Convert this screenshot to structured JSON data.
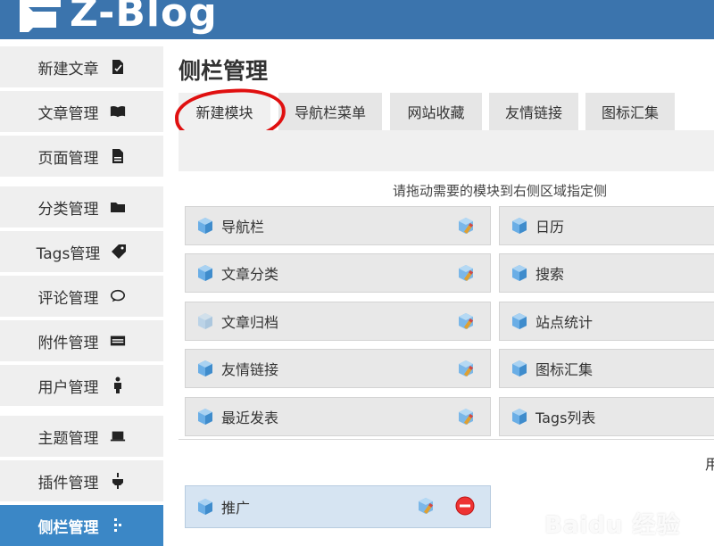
{
  "brand": {
    "logo_text": "Z-Blog"
  },
  "sidebar": {
    "items": [
      {
        "label": "新建文章",
        "icon": "edit-doc-icon"
      },
      {
        "label": "文章管理",
        "icon": "book-icon"
      },
      {
        "label": "页面管理",
        "icon": "page-icon"
      },
      {
        "label": "分类管理",
        "icon": "folder-icon"
      },
      {
        "label": "Tags管理",
        "icon": "tag-icon"
      },
      {
        "label": "评论管理",
        "icon": "comment-icon"
      },
      {
        "label": "附件管理",
        "icon": "attachment-icon"
      },
      {
        "label": "用户管理",
        "icon": "user-icon"
      },
      {
        "label": "主题管理",
        "icon": "theme-icon"
      },
      {
        "label": "插件管理",
        "icon": "plugin-icon"
      },
      {
        "label": "侧栏管理",
        "icon": "sidebar-icon"
      }
    ],
    "active": "侧栏管理"
  },
  "main": {
    "title": "侧栏管理",
    "tabs": [
      {
        "label": "新建模块"
      },
      {
        "label": "导航栏菜单"
      },
      {
        "label": "网站收藏"
      },
      {
        "label": "友情链接"
      },
      {
        "label": "图标汇集"
      }
    ],
    "hint": "请拖动需要的模块到右侧区域指定侧",
    "modules_left": [
      {
        "label": "导航栏"
      },
      {
        "label": "文章分类"
      },
      {
        "label": "文章归档"
      },
      {
        "label": "友情链接"
      },
      {
        "label": "最近发表"
      }
    ],
    "modules_right": [
      {
        "label": "日历"
      },
      {
        "label": "搜索"
      },
      {
        "label": "站点统计"
      },
      {
        "label": "图标汇集"
      },
      {
        "label": "Tags列表"
      }
    ],
    "more_text": "用",
    "custom_module": {
      "label": "推广"
    }
  },
  "colors": {
    "header": "#3b74ad",
    "active_sidebar": "#3b87c6",
    "annotation": "#e01010"
  },
  "watermark": "Baidu 经验"
}
